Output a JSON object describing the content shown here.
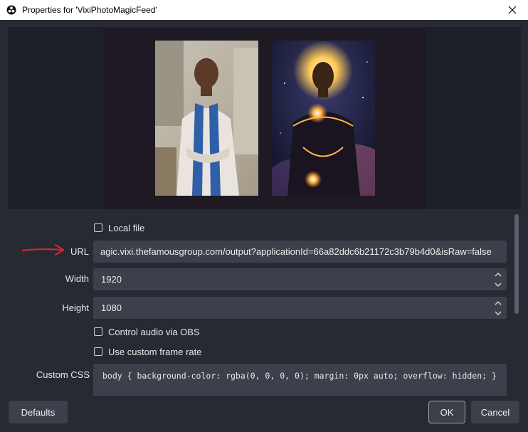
{
  "window": {
    "title": "Properties for 'VixiPhotoMagicFeed'"
  },
  "form": {
    "local_file_label": "Local file",
    "url_label": "URL",
    "url_value": "agic.vixi.thefamousgroup.com/output?applicationId=66a82ddc6b21172c3b79b4d0&isRaw=false",
    "width_label": "Width",
    "width_value": "1920",
    "height_label": "Height",
    "height_value": "1080",
    "control_audio_label": "Control audio via OBS",
    "custom_frame_rate_label": "Use custom frame rate",
    "custom_css_label": "Custom CSS",
    "custom_css_value": "body { background-color: rgba(0, 0, 0, 0); margin: 0px auto; overflow: hidden; }"
  },
  "buttons": {
    "defaults": "Defaults",
    "ok": "OK",
    "cancel": "Cancel"
  },
  "colors": {
    "background": "#272a33",
    "field": "#3c404b",
    "annotation_arrow": "#d42a2a"
  },
  "icons": {
    "app": "obs-logo-icon",
    "close": "close-icon",
    "spin_up": "chevron-up-icon",
    "spin_down": "chevron-down-icon"
  }
}
